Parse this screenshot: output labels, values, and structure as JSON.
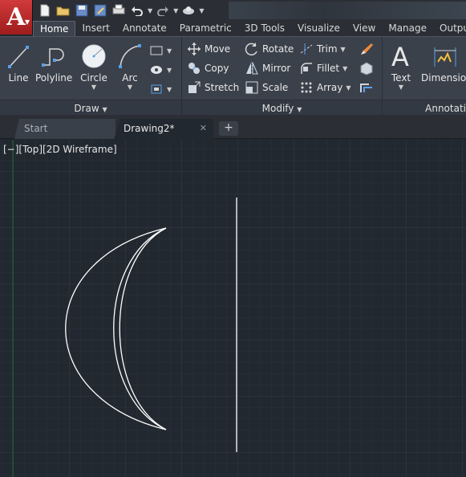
{
  "app": {
    "logo_letter": "A"
  },
  "quick_access": {
    "icons": [
      "new-file-icon",
      "open-folder-icon",
      "save-icon",
      "save-as-icon",
      "plot-icon",
      "undo-icon",
      "redo-icon",
      "workspace-icon",
      "customize-icon"
    ]
  },
  "ribbon_tabs": [
    "Home",
    "Insert",
    "Annotate",
    "Parametric",
    "3D Tools",
    "Visualize",
    "View",
    "Manage",
    "Output"
  ],
  "panels": {
    "draw": {
      "title": "Draw",
      "tools": {
        "line": "Line",
        "polyline": "Polyline",
        "circle": "Circle",
        "arc": "Arc"
      }
    },
    "modify": {
      "title": "Modify",
      "tools": {
        "move": "Move",
        "rotate": "Rotate",
        "trim": "Trim",
        "copy": "Copy",
        "mirror": "Mirror",
        "fillet": "Fillet",
        "stretch": "Stretch",
        "scale": "Scale",
        "array": "Array"
      }
    },
    "annotation": {
      "title": "Annotati",
      "tools": {
        "text": "Text",
        "dimension": "Dimension"
      }
    }
  },
  "file_tabs": {
    "start": "Start",
    "drawing": "Drawing2*",
    "close_glyph": "✕",
    "new_glyph": "+"
  },
  "viewport": {
    "label": "[−][Top][2D Wireframe]"
  },
  "colors": {
    "canvas_bg": "#212830",
    "app_red": "#c62f2f",
    "geometry": "#ffffff",
    "ucs_axis": "#1f6b2c"
  }
}
